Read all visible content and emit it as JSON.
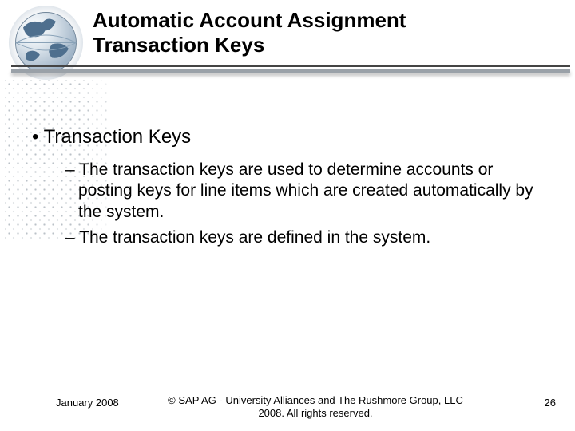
{
  "header": {
    "title_line1": "Automatic Account Assignment",
    "title_line2": "Transaction Keys"
  },
  "content": {
    "bullet": "Transaction Keys",
    "subs": [
      "The transaction keys are used to determine accounts or posting keys for line items which are created automatically by the system.",
      "The transaction keys are defined in the system."
    ]
  },
  "footer": {
    "date": "January 2008",
    "copyright": "© SAP AG - University Alliances and The Rushmore Group, LLC 2008. All rights reserved.",
    "page": "26"
  },
  "icons": {
    "globe": "globe-icon"
  }
}
